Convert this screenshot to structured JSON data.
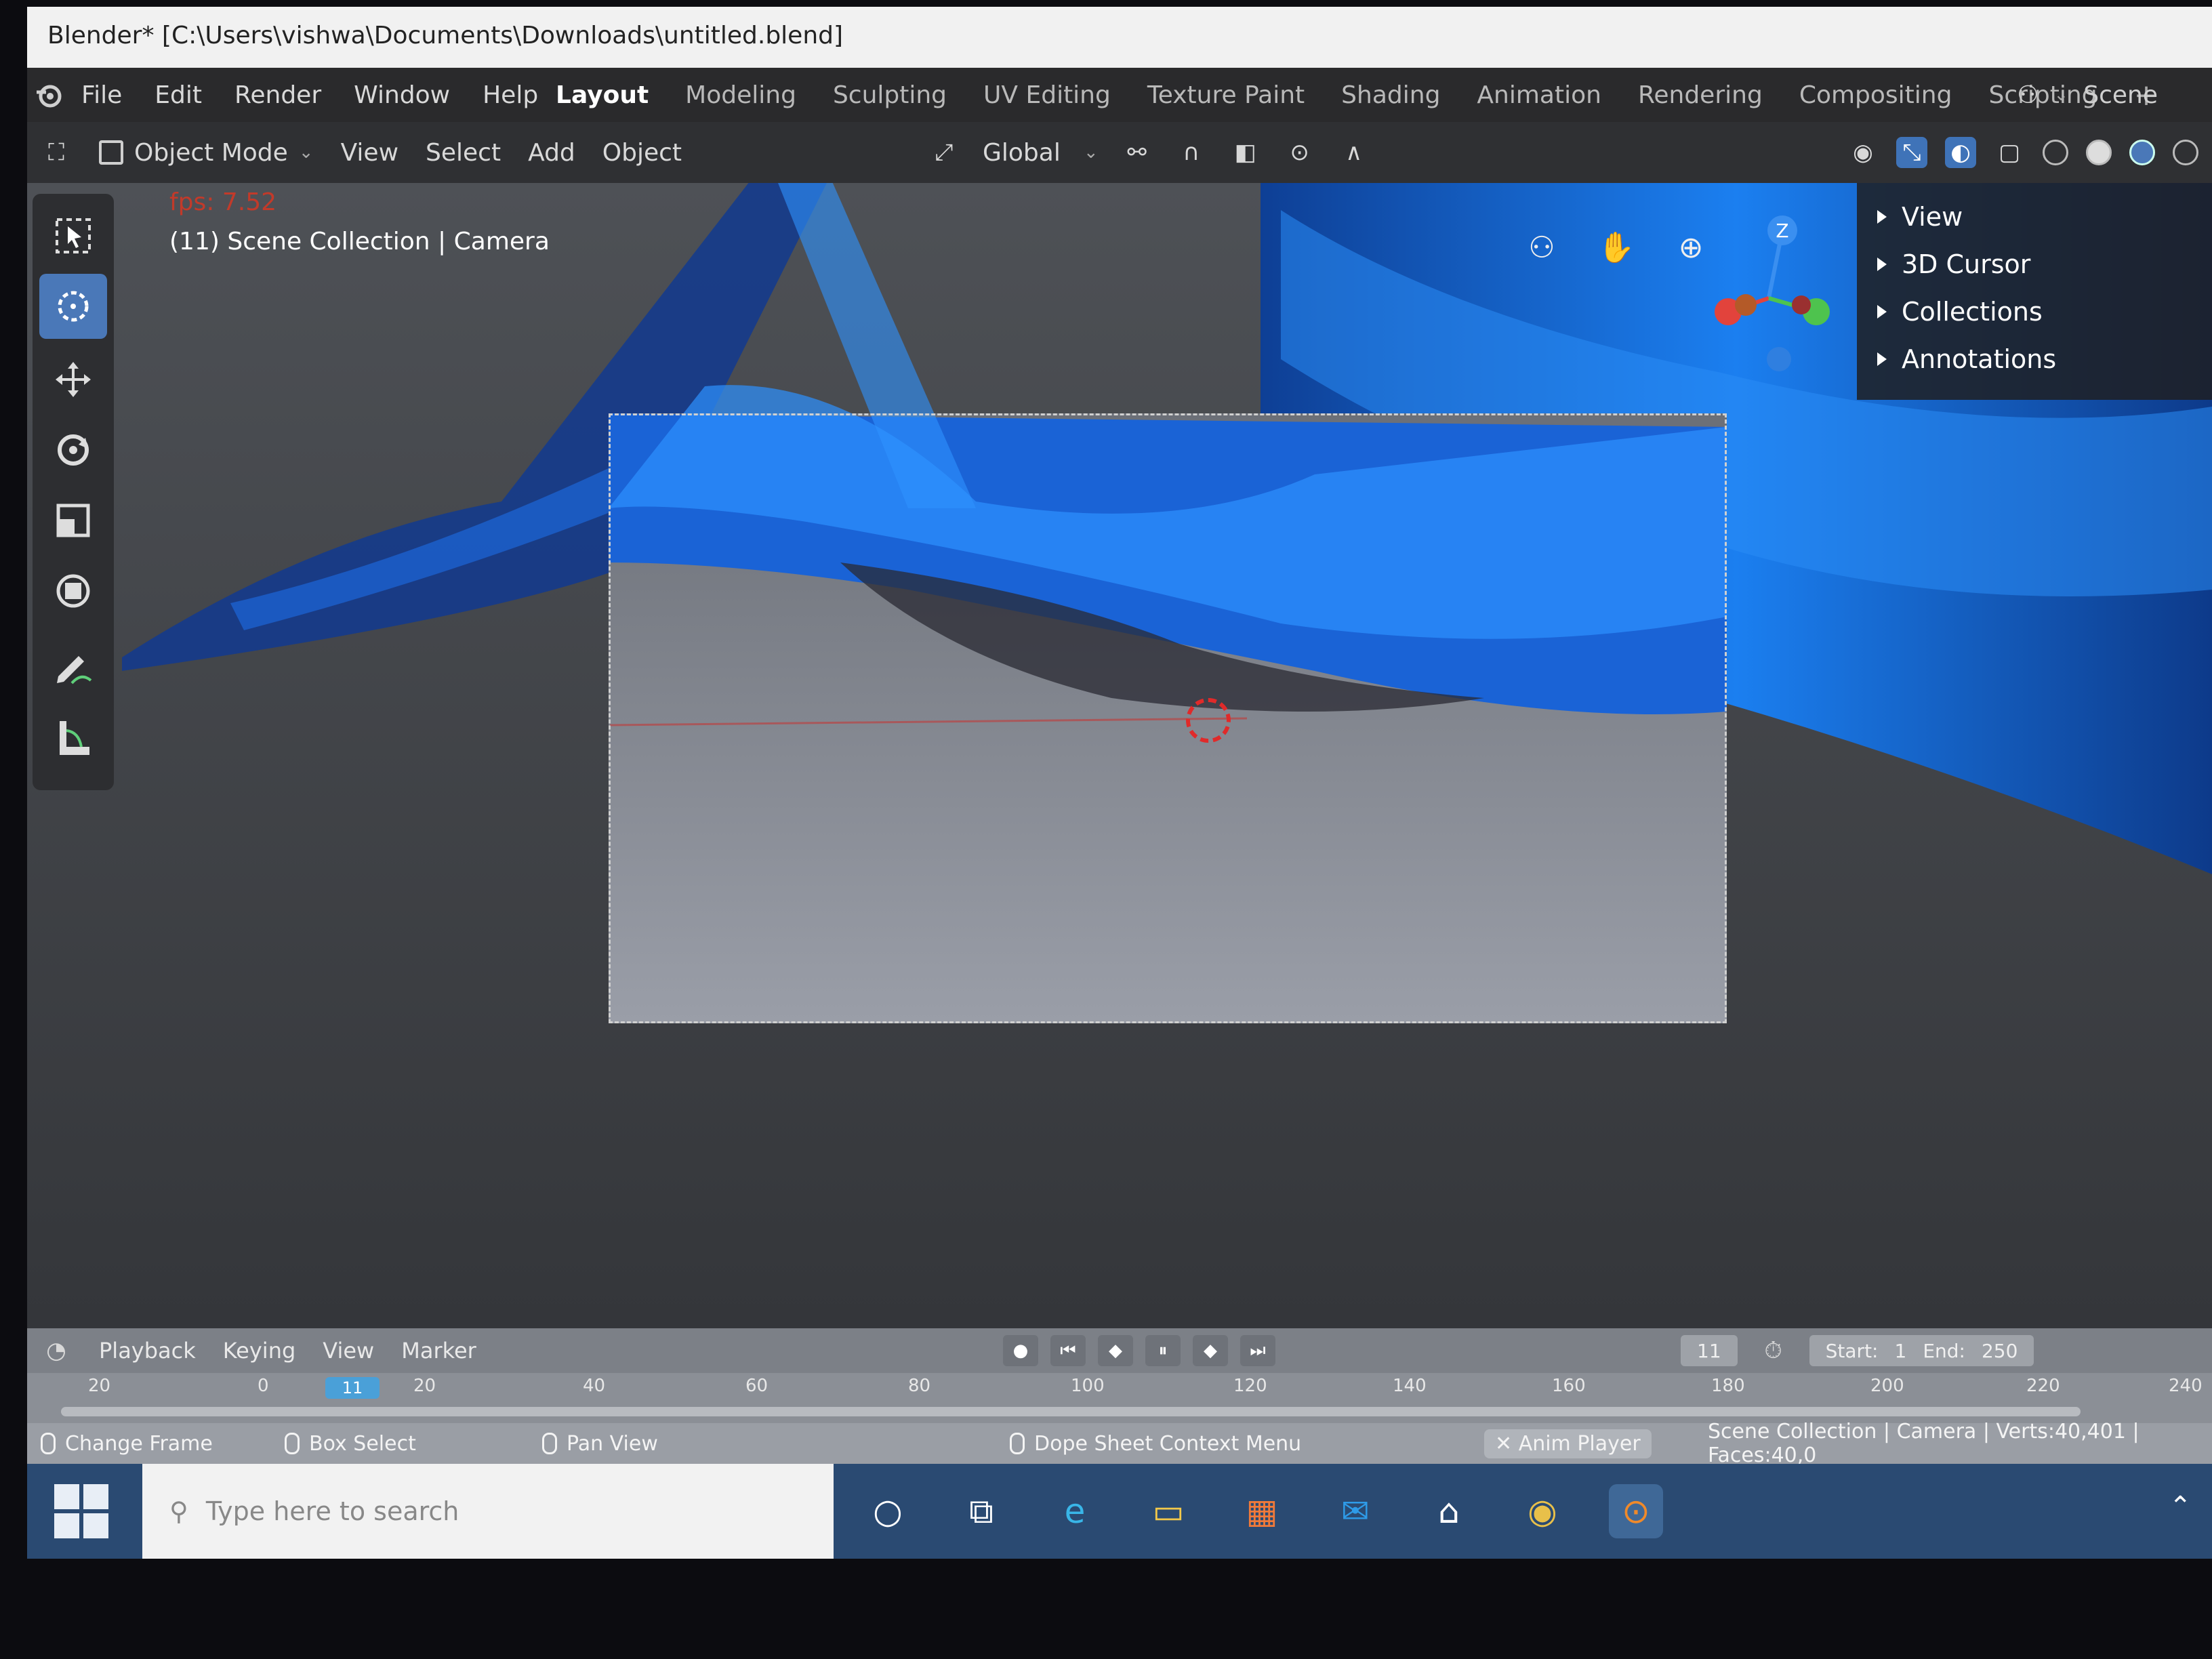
{
  "window": {
    "title": "Blender* [C:\\Users\\vishwa\\Documents\\Downloads\\untitled.blend]"
  },
  "menu": {
    "items": [
      "File",
      "Edit",
      "Render",
      "Window",
      "Help"
    ]
  },
  "workspaces": {
    "tabs": [
      "Layout",
      "Modeling",
      "Sculpting",
      "UV Editing",
      "Texture Paint",
      "Shading",
      "Animation",
      "Rendering",
      "Compositing",
      "Scripting"
    ],
    "active": "Layout",
    "add": "+"
  },
  "scene": {
    "label": "Scene"
  },
  "header": {
    "mode": "Object Mode",
    "items": [
      "View",
      "Select",
      "Add",
      "Object"
    ],
    "orientation": "Global"
  },
  "viewport": {
    "fps": "fps: 7.52",
    "object_info": "(11) Scene Collection | Camera",
    "npanel": [
      "View",
      "3D Cursor",
      "Collections",
      "Annotations"
    ],
    "axis_z": "Z"
  },
  "timeline": {
    "menu": [
      "Playback",
      "Keying",
      "View",
      "Marker"
    ],
    "current_frame": "11",
    "start_label": "Start:",
    "start": "1",
    "end_label": "End:",
    "end": "250",
    "ticks": [
      "20",
      "0",
      "20",
      "40",
      "60",
      "80",
      "100",
      "120",
      "140",
      "160",
      "180",
      "200",
      "220",
      "240"
    ],
    "playhead": "11"
  },
  "status": {
    "change_frame": "Change Frame",
    "box_select": "Box Select",
    "pan_view": "Pan View",
    "context_menu": "Dope Sheet Context Menu",
    "anim_player": "Anim Player",
    "stats": "Scene Collection | Camera | Verts:40,401 | Faces:40,0"
  },
  "taskbar": {
    "search_placeholder": "Type here to search"
  },
  "colors": {
    "accent": "#4a78b8",
    "fps_red": "#c23a2a",
    "timeline": "#8b8f96"
  }
}
